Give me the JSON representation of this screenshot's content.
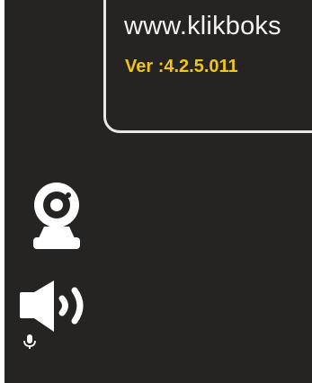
{
  "app": {
    "website": "www.klikboks",
    "version_label": "Ver :4.2.5.011"
  },
  "controls": {
    "webcam_icon": "webcam-icon",
    "speaker_icon": "speaker-icon",
    "mic_icon": "microphone-icon"
  },
  "colors": {
    "background": "#252422",
    "frame": "#e8e8e8",
    "text": "#f2f2f2",
    "version": "#f0c419"
  }
}
